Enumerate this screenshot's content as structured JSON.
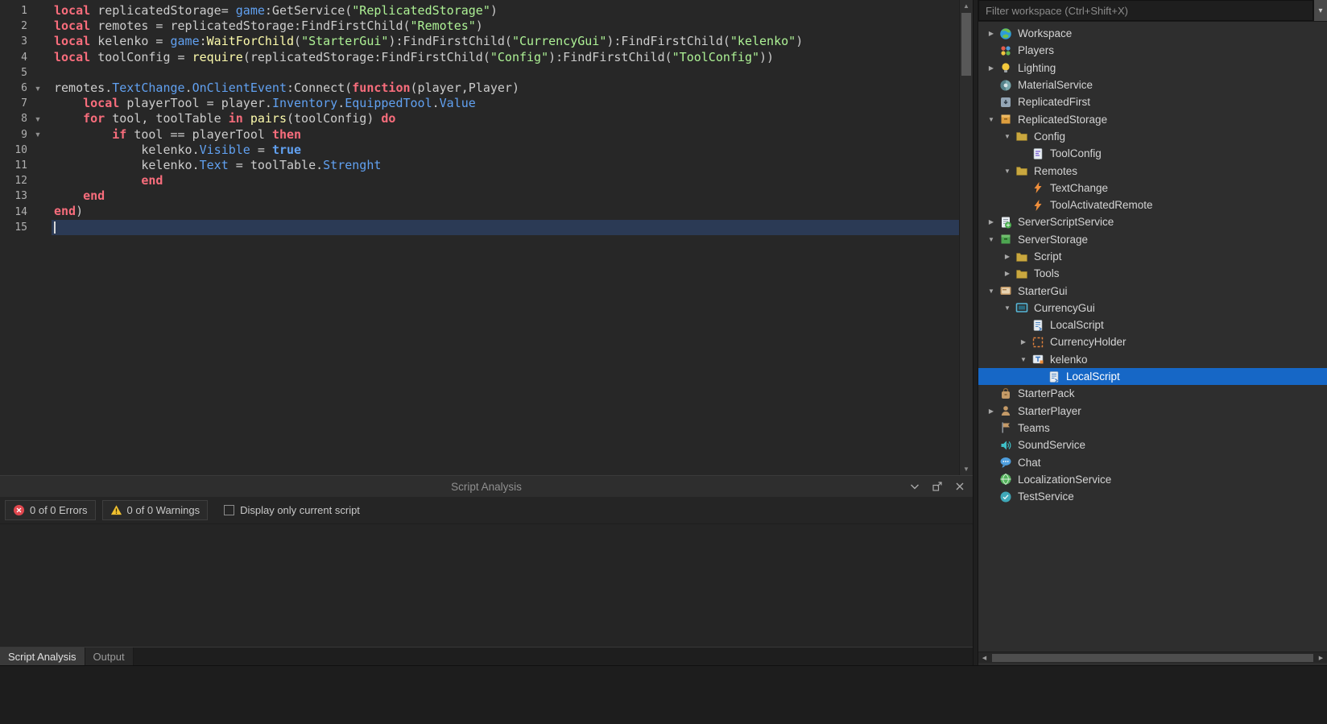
{
  "colors": {
    "selection_blue": "#1667C6",
    "keyword_pink": "#F86D7C",
    "string_green": "#ADF195",
    "property_blue": "#61A1F1",
    "builtin_yellow": "#FDFBAC",
    "plain_text": "#CCCCCC",
    "error_red": "#E0474E",
    "warning_yellow": "#F0C030",
    "current_line_bg": "#2B3A55"
  },
  "editor": {
    "current_line": 15,
    "lines": [
      {
        "n": 1,
        "fold": "",
        "tokens": [
          [
            "kw",
            "local "
          ],
          [
            "pl",
            "replicatedStorage= "
          ],
          [
            "gl",
            "game"
          ],
          [
            "pl",
            ":GetService("
          ],
          [
            "st",
            "\"ReplicatedStorage\""
          ],
          [
            "pl",
            ")"
          ]
        ]
      },
      {
        "n": 2,
        "fold": "",
        "tokens": [
          [
            "kw",
            "local "
          ],
          [
            "pl",
            "remotes = replicatedStorage:FindFirstChild("
          ],
          [
            "st",
            "\"Remotes\""
          ],
          [
            "pl",
            ")"
          ]
        ]
      },
      {
        "n": 3,
        "fold": "",
        "tokens": [
          [
            "kw",
            "local "
          ],
          [
            "pl",
            "kelenko = "
          ],
          [
            "gl",
            "game"
          ],
          [
            "pl",
            ":"
          ],
          [
            "bi",
            "WaitForChild"
          ],
          [
            "pl",
            "("
          ],
          [
            "st",
            "\"StarterGui\""
          ],
          [
            "pl",
            "):FindFirstChild("
          ],
          [
            "st",
            "\"CurrencyGui\""
          ],
          [
            "pl",
            "):FindFirstChild("
          ],
          [
            "st",
            "\"kelenko\""
          ],
          [
            "pl",
            ")"
          ]
        ]
      },
      {
        "n": 4,
        "fold": "",
        "tokens": [
          [
            "kw",
            "local "
          ],
          [
            "pl",
            "toolConfig = "
          ],
          [
            "bi",
            "require"
          ],
          [
            "pl",
            "(replicatedStorage:FindFirstChild("
          ],
          [
            "st",
            "\"Config\""
          ],
          [
            "pl",
            "):FindFirstChild("
          ],
          [
            "st",
            "\"ToolConfig\""
          ],
          [
            "pl",
            "))"
          ]
        ]
      },
      {
        "n": 5,
        "fold": "",
        "tokens": []
      },
      {
        "n": 6,
        "fold": "down",
        "tokens": [
          [
            "pl",
            "remotes."
          ],
          [
            "gl",
            "TextChange"
          ],
          [
            "pl",
            "."
          ],
          [
            "gl",
            "OnClientEvent"
          ],
          [
            "pl",
            ":Connect("
          ],
          [
            "kw",
            "function"
          ],
          [
            "pl",
            "(player,Player)"
          ]
        ]
      },
      {
        "n": 7,
        "fold": "",
        "tokens": [
          [
            "pl",
            "    "
          ],
          [
            "kw",
            "local "
          ],
          [
            "pl",
            "playerTool = player."
          ],
          [
            "gl",
            "Inventory"
          ],
          [
            "pl",
            "."
          ],
          [
            "gl",
            "EquippedTool"
          ],
          [
            "pl",
            "."
          ],
          [
            "gl",
            "Value"
          ]
        ]
      },
      {
        "n": 8,
        "fold": "down",
        "tokens": [
          [
            "pl",
            "    "
          ],
          [
            "kw",
            "for "
          ],
          [
            "pl",
            "tool, toolTable "
          ],
          [
            "kw",
            "in "
          ],
          [
            "bi",
            "pairs"
          ],
          [
            "pl",
            "(toolConfig) "
          ],
          [
            "kw",
            "do"
          ]
        ]
      },
      {
        "n": 9,
        "fold": "down",
        "tokens": [
          [
            "pl",
            "        "
          ],
          [
            "kw",
            "if "
          ],
          [
            "pl",
            "tool == playerTool "
          ],
          [
            "kw",
            "then"
          ]
        ]
      },
      {
        "n": 10,
        "fold": "",
        "tokens": [
          [
            "pl",
            "            kelenko."
          ],
          [
            "gl",
            "Visible"
          ],
          [
            "pl",
            " = "
          ],
          [
            "kb",
            "true"
          ]
        ]
      },
      {
        "n": 11,
        "fold": "",
        "tokens": [
          [
            "pl",
            "            kelenko."
          ],
          [
            "gl",
            "Text"
          ],
          [
            "pl",
            " = toolTable."
          ],
          [
            "gl",
            "Strenght"
          ]
        ]
      },
      {
        "n": 12,
        "fold": "",
        "tokens": [
          [
            "pl",
            "            "
          ],
          [
            "kw",
            "end"
          ]
        ]
      },
      {
        "n": 13,
        "fold": "",
        "tokens": [
          [
            "pl",
            "    "
          ],
          [
            "kw",
            "end"
          ]
        ]
      },
      {
        "n": 14,
        "fold": "",
        "tokens": [
          [
            "kw",
            "end"
          ],
          [
            "pl",
            ")"
          ]
        ]
      },
      {
        "n": 15,
        "fold": "",
        "tokens": []
      }
    ]
  },
  "analysis": {
    "title": "Script Analysis",
    "errors_label": "0 of 0 Errors",
    "warnings_label": "0 of 0 Warnings",
    "checkbox_label": "Display only current script",
    "tabs": [
      {
        "label": "Script Analysis",
        "active": true
      },
      {
        "label": "Output",
        "active": false
      }
    ]
  },
  "explorer": {
    "filter_placeholder": "Filter workspace (Ctrl+Shift+X)",
    "items": [
      {
        "label": "Workspace",
        "icon": "workspace-icon",
        "level": 0,
        "arrow": "right"
      },
      {
        "label": "Players",
        "icon": "players-icon",
        "level": 0,
        "arrow": "none"
      },
      {
        "label": "Lighting",
        "icon": "lighting-icon",
        "level": 0,
        "arrow": "right"
      },
      {
        "label": "MaterialService",
        "icon": "material-service-icon",
        "level": 0,
        "arrow": "none"
      },
      {
        "label": "ReplicatedFirst",
        "icon": "replicated-first-icon",
        "level": 0,
        "arrow": "none"
      },
      {
        "label": "ReplicatedStorage",
        "icon": "replicated-storage-icon",
        "level": 0,
        "arrow": "down"
      },
      {
        "label": "Config",
        "icon": "folder-icon",
        "level": 1,
        "arrow": "down"
      },
      {
        "label": "ToolConfig",
        "icon": "module-script-icon",
        "level": 2,
        "arrow": "none"
      },
      {
        "label": "Remotes",
        "icon": "folder-icon",
        "level": 1,
        "arrow": "down"
      },
      {
        "label": "TextChange",
        "icon": "remote-event-icon",
        "level": 2,
        "arrow": "none"
      },
      {
        "label": "ToolActivatedRemote",
        "icon": "remote-event-icon",
        "level": 2,
        "arrow": "none"
      },
      {
        "label": "ServerScriptService",
        "icon": "server-script-service-icon",
        "level": 0,
        "arrow": "right"
      },
      {
        "label": "ServerStorage",
        "icon": "server-storage-icon",
        "level": 0,
        "arrow": "down"
      },
      {
        "label": "Script",
        "icon": "folder-icon",
        "level": 1,
        "arrow": "right"
      },
      {
        "label": "Tools",
        "icon": "folder-icon",
        "level": 1,
        "arrow": "right"
      },
      {
        "label": "StarterGui",
        "icon": "starter-gui-icon",
        "level": 0,
        "arrow": "down"
      },
      {
        "label": "CurrencyGui",
        "icon": "screen-gui-icon",
        "level": 1,
        "arrow": "down"
      },
      {
        "label": "LocalScript",
        "icon": "local-script-icon",
        "level": 2,
        "arrow": "none"
      },
      {
        "label": "CurrencyHolder",
        "icon": "frame-icon",
        "level": 2,
        "arrow": "right"
      },
      {
        "label": "kelenko",
        "icon": "text-label-icon",
        "level": 2,
        "arrow": "down"
      },
      {
        "label": "LocalScript",
        "icon": "local-script-icon",
        "level": 3,
        "arrow": "none",
        "selected": true
      },
      {
        "label": "StarterPack",
        "icon": "starter-pack-icon",
        "level": 0,
        "arrow": "none"
      },
      {
        "label": "StarterPlayer",
        "icon": "starter-player-icon",
        "level": 0,
        "arrow": "right"
      },
      {
        "label": "Teams",
        "icon": "teams-icon",
        "level": 0,
        "arrow": "none"
      },
      {
        "label": "SoundService",
        "icon": "sound-service-icon",
        "level": 0,
        "arrow": "none"
      },
      {
        "label": "Chat",
        "icon": "chat-icon",
        "level": 0,
        "arrow": "none"
      },
      {
        "label": "LocalizationService",
        "icon": "localization-service-icon",
        "level": 0,
        "arrow": "none"
      },
      {
        "label": "TestService",
        "icon": "test-service-icon",
        "level": 0,
        "arrow": "none"
      }
    ]
  }
}
